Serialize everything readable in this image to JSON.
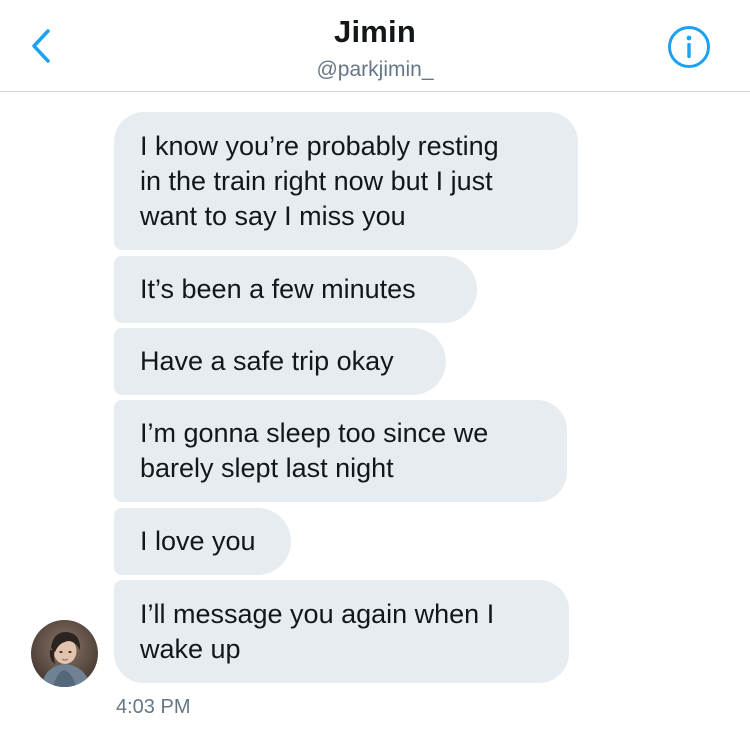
{
  "header": {
    "title": "Jimin",
    "handle": "@parkjimin_"
  },
  "messages": [
    {
      "text": "I know you’re probably resting\nin the train right now but I just\nwant to say I miss you"
    },
    {
      "text": "It’s been a few minutes"
    },
    {
      "text": "Have a safe trip okay"
    },
    {
      "text": "I’m gonna sleep too since we\nbarely slept last night"
    },
    {
      "text": "I love you"
    },
    {
      "text": "I’ll message you again when I\nwake up"
    }
  ],
  "timestamp": "4:03 PM",
  "colors": {
    "accent": "#1da1f2",
    "bubble": "#e6ecf0",
    "text": "#14171a",
    "secondary_text": "#657786"
  }
}
